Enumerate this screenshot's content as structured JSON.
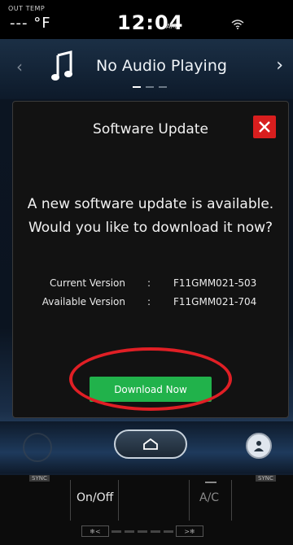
{
  "status": {
    "out_temp_label": "OUT TEMP",
    "out_temp_value": "--- °F",
    "time": "12:04",
    "ampm": "AM"
  },
  "audio": {
    "now_playing": "No Audio Playing",
    "prev_icon": "chevron-left-icon",
    "next_icon": "chevron-right-icon"
  },
  "dialog": {
    "title": "Software Update",
    "message": "A new software update is available. Would you like to download it now?",
    "versions": [
      {
        "label": "Current Version",
        "separator": ":",
        "value": "F11GMM021-503"
      },
      {
        "label": "Available Version",
        "separator": ":",
        "value": "F11GMM021-704"
      }
    ],
    "download_label": "Download Now",
    "close_color": "#d81e1e",
    "download_color": "#21b24b"
  },
  "climate": {
    "sync_left": "SYNC",
    "sync_right": "SYNC",
    "onoff_label": "On/Off",
    "ac_label": "A/C"
  },
  "colors": {
    "highlight_ring": "#e01f25"
  }
}
